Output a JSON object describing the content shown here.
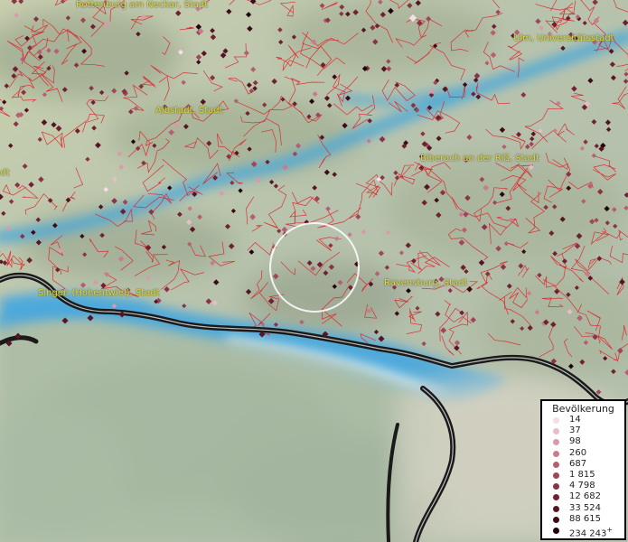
{
  "cities": [
    {
      "name": "Rottenburg am Neckar, Stadt"
    },
    {
      "name": "Ulm, Universitätsstadt"
    },
    {
      "name": "Albstadt, Stadt"
    },
    {
      "name": "Biberach an der Riß, Stadt"
    },
    {
      "name": "Singen (Hohentwiel), Stadt"
    },
    {
      "name": "Ravensburg, Stadt"
    },
    {
      "name": "Stadt"
    }
  ],
  "legend": {
    "title": "Bevölkerung",
    "items": [
      {
        "label": "14",
        "color": "#f6dde6"
      },
      {
        "label": "37",
        "color": "#e8bcc9"
      },
      {
        "label": "98",
        "color": "#d99aab"
      },
      {
        "label": "260",
        "color": "#c97c8e"
      },
      {
        "label": "687",
        "color": "#b65f72"
      },
      {
        "label": "1 815",
        "color": "#a04659"
      },
      {
        "label": "4 798",
        "color": "#893344"
      },
      {
        "label": "12 682",
        "color": "#6f2132"
      },
      {
        "label": "33 524",
        "color": "#551522"
      },
      {
        "label": "88 615",
        "color": "#3c0b16"
      },
      {
        "label": "234 243",
        "color": "#22050b",
        "suffix": "+"
      }
    ]
  },
  "colors": {
    "boundary": "#e0202a",
    "river": "#4aa8d8",
    "lake": "#2f93cf",
    "terrain": "#b9c7b0",
    "label": "#dede2a",
    "highlight": "#ffffff"
  }
}
